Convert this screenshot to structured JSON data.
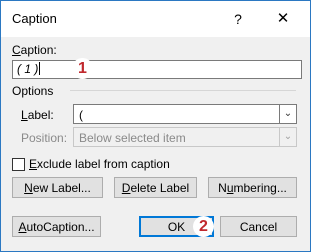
{
  "window": {
    "title": "Caption",
    "help_label": "?",
    "close_label": "✕"
  },
  "caption": {
    "label": "Caption:",
    "value": "( 1 )"
  },
  "options": {
    "heading": "Options",
    "label_label": "Label:",
    "label_value": "(",
    "position_label": "Position:",
    "position_value": "Below selected item"
  },
  "exclude_checkbox": {
    "label": "Exclude label from caption",
    "checked": false
  },
  "buttons": {
    "new_label": "New Label...",
    "delete_label": "Delete Label",
    "numbering": "Numbering...",
    "autocaption": "AutoCaption...",
    "ok": "OK",
    "cancel": "Cancel"
  },
  "badges": {
    "one": "1",
    "two": "2"
  },
  "colors": {
    "accent": "#0078d7",
    "badge_text": "#c0282d"
  }
}
